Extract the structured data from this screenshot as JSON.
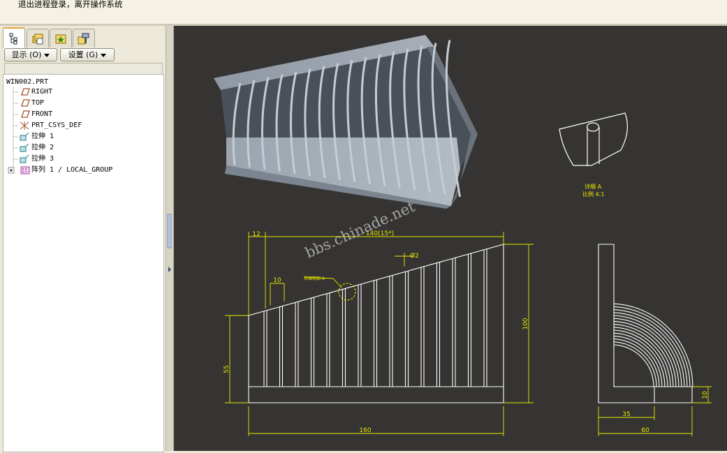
{
  "message_bar": {
    "text": "退出进程登录，离开操作系统"
  },
  "nav_tabs": [
    {
      "name": "model-tree",
      "icon": "model-tree-icon"
    },
    {
      "name": "folder-browser",
      "icon": "folder-browser-icon"
    },
    {
      "name": "favorites",
      "icon": "favorites-icon"
    },
    {
      "name": "connections",
      "icon": "connections-icon"
    }
  ],
  "toolbar": {
    "show_label": "显示 (O)",
    "settings_label": "设置 (G)"
  },
  "tree": {
    "root": "WIN002.PRT",
    "items": [
      {
        "label": "RIGHT",
        "icon": "datum-plane-icon"
      },
      {
        "label": "TOP",
        "icon": "datum-plane-icon"
      },
      {
        "label": "FRONT",
        "icon": "datum-plane-icon"
      },
      {
        "label": "PRT_CSYS_DEF",
        "icon": "coordinate-system-icon"
      },
      {
        "label": "拉伸 1",
        "icon": "extrude-icon"
      },
      {
        "label": "拉伸 2",
        "icon": "extrude-icon"
      },
      {
        "label": "拉伸 3",
        "icon": "extrude-icon"
      },
      {
        "label": "阵列 1 / LOCAL_GROUP",
        "icon": "pattern-icon"
      }
    ]
  },
  "drawing": {
    "watermark": "bbs.chinade.net",
    "detail_view_label": "详细 A",
    "detail_scale_label": "比例 4:1",
    "detail_callout_label": "详细视图 A",
    "dimensions": {
      "top_offset": "12",
      "top_length": "140(15*)",
      "diameter": "Ø2",
      "spacing": "10",
      "left_height": "55",
      "right_height": "100",
      "bottom_length": "160",
      "base_thickness": "10",
      "inner_width": "35",
      "total_width": "60"
    }
  },
  "colors": {
    "viewport": "#353432",
    "dimension": "#e8e800",
    "geometry": "#ffffff",
    "model_face": "#9aa3ad"
  }
}
